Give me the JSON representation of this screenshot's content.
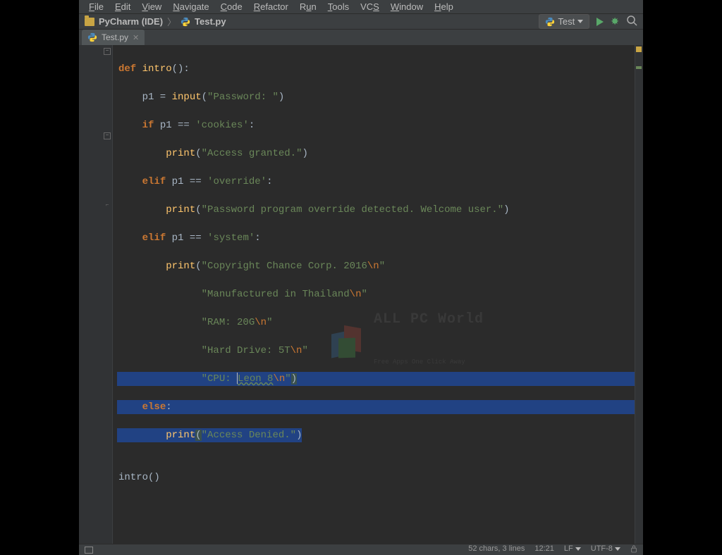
{
  "menu": {
    "file": "File",
    "edit": "Edit",
    "view": "View",
    "navigate": "Navigate",
    "code": "Code",
    "refactor": "Refactor",
    "run": "Run",
    "tools": "Tools",
    "vcs": "VCS",
    "window": "Window",
    "help": "Help"
  },
  "toolbar": {
    "project": "PyCharm (IDE)",
    "file": "Test.py",
    "run_config": "Test"
  },
  "tabs": {
    "active": "Test.py"
  },
  "code": {
    "l1_def": "def ",
    "l1_fn": "intro",
    "l1_rest": "():",
    "l2a": "    p1 = ",
    "l2b": "input",
    "l2c": "(",
    "l2d": "\"Password: \"",
    "l2e": ")",
    "l3a": "    ",
    "l3b": "if ",
    "l3c": "p1 == ",
    "l3d": "'cookies'",
    "l3e": ":",
    "l4a": "        ",
    "l4b": "print",
    "l4c": "(",
    "l4d": "\"Access granted.\"",
    "l4e": ")",
    "l5a": "    ",
    "l5b": "elif ",
    "l5c": "p1 == ",
    "l5d": "'override'",
    "l5e": ":",
    "l6a": "        ",
    "l6b": "print",
    "l6c": "(",
    "l6d": "\"Password program override detected. Welcome user.\"",
    "l6e": ")",
    "l7a": "    ",
    "l7b": "elif ",
    "l7c": "p1 == ",
    "l7d": "'system'",
    "l7e": ":",
    "l8a": "        ",
    "l8b": "print",
    "l8c": "(",
    "l8d": "\"Copyright Chance Corp. 2016",
    "l8e": "\\n",
    "l8f": "\"",
    "l9a": "              ",
    "l9b": "\"Manufactured in Thailand",
    "l9c": "\\n",
    "l9d": "\"",
    "l10a": "              ",
    "l10b": "\"RAM: 20G",
    "l10c": "\\n",
    "l10d": "\"",
    "l11a": "              ",
    "l11b": "\"Hard Drive: 5T",
    "l11c": "\\n",
    "l11d": "\"",
    "l12a": "              ",
    "l12b": "\"CPU: ",
    "l12c": "Leon 8",
    "l12d": "\\n",
    "l12e": "\"",
    "l12f": ")",
    "l13a": "    ",
    "l13b": "else",
    "l13c": ":",
    "l14a": "        ",
    "l14b": "print",
    "l14c": "(",
    "l14d": "\"Access Denied.\"",
    "l14e": ")",
    "l15": " ",
    "l16a": "intro",
    "l16b": "()"
  },
  "status": {
    "selection": "52 chars, 3 lines",
    "pos": "12:21",
    "line_sep": "LF",
    "encoding": "UTF-8"
  },
  "watermark": {
    "title": "ALL PC World",
    "subtitle": "Free Apps One Click Away"
  }
}
